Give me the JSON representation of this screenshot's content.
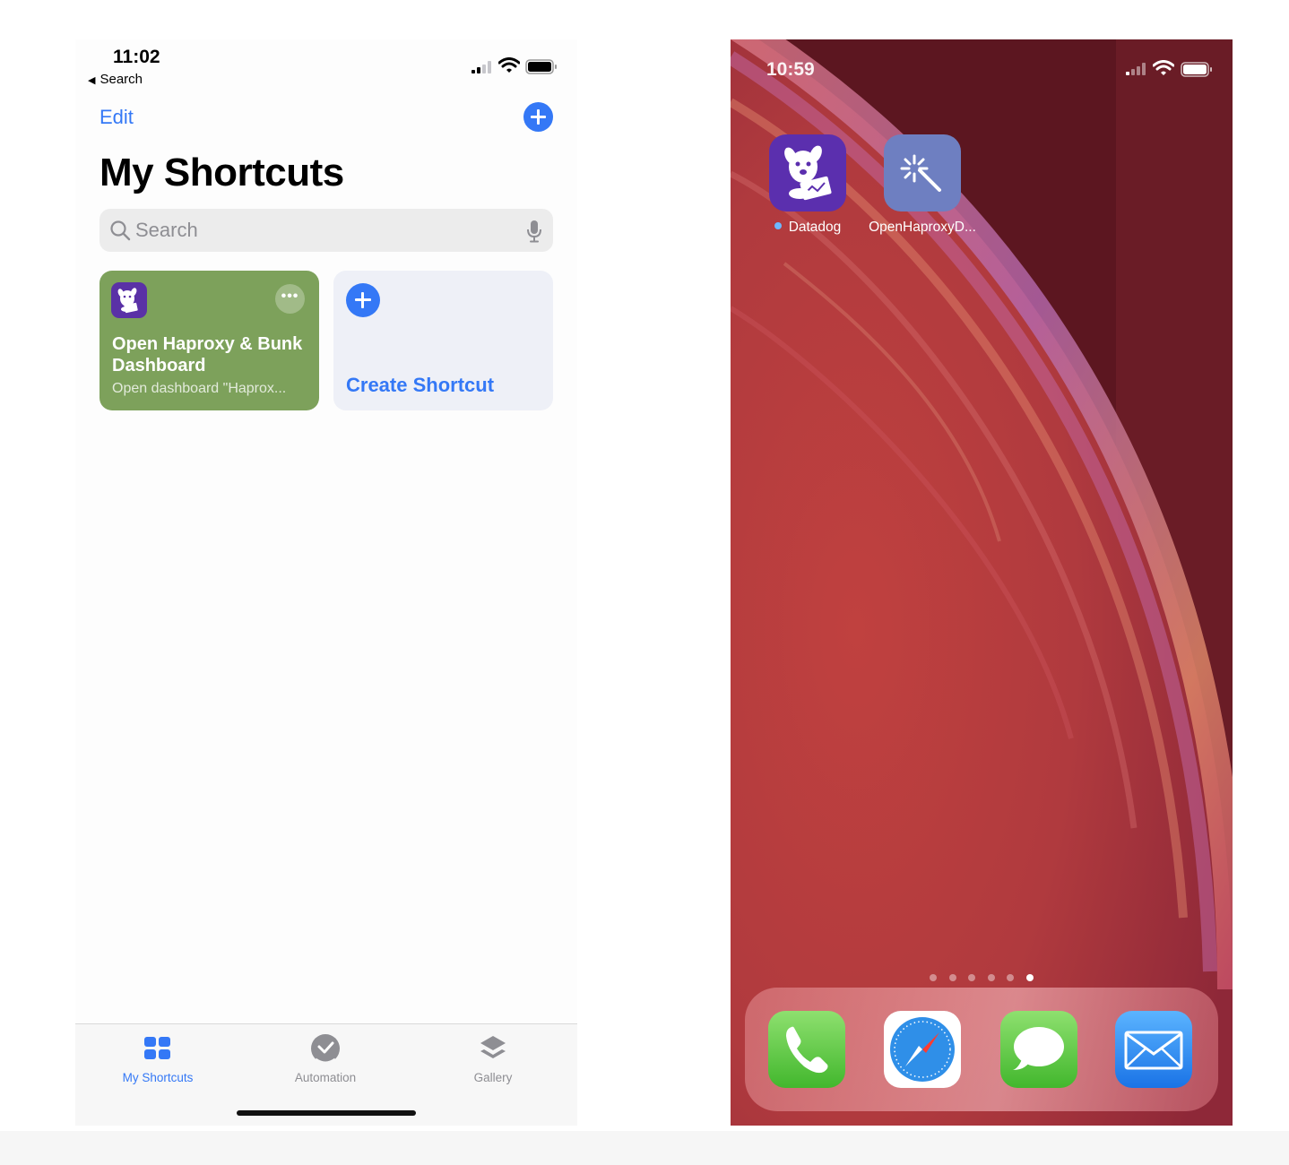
{
  "left_phone": {
    "status_bar": {
      "time": "11:02",
      "back_label": "Search"
    },
    "nav": {
      "edit_label": "Edit"
    },
    "title": "My Shortcuts",
    "search": {
      "placeholder": "Search"
    },
    "shortcut_tile": {
      "title": "Open Haproxy & Bunk Dashboard",
      "subtitle": "Open dashboard \"Haprox...",
      "color": "#7da15b",
      "icon": "datadog-dog-icon"
    },
    "create_tile": {
      "label": "Create Shortcut"
    },
    "tabs": [
      {
        "label": "My Shortcuts",
        "icon": "grid-icon",
        "selected": true
      },
      {
        "label": "Automation",
        "icon": "checkmark-circle-icon",
        "selected": false
      },
      {
        "label": "Gallery",
        "icon": "layers-icon",
        "selected": false
      }
    ],
    "accent_color": "#3478f6"
  },
  "right_phone": {
    "status_bar": {
      "time": "10:59"
    },
    "apps": [
      {
        "label": "Datadog",
        "icon": "datadog-dog-icon",
        "newly_installed": true
      },
      {
        "label": "OpenHaproxyD...",
        "icon": "magic-wand-icon",
        "newly_installed": false
      }
    ],
    "page_dots": {
      "count": 6,
      "active_index": 5
    },
    "dock": [
      {
        "name": "Phone",
        "icon": "phone-icon"
      },
      {
        "name": "Safari",
        "icon": "compass-icon"
      },
      {
        "name": "Messages",
        "icon": "speech-bubble-icon"
      },
      {
        "name": "Mail",
        "icon": "envelope-icon"
      }
    ]
  }
}
